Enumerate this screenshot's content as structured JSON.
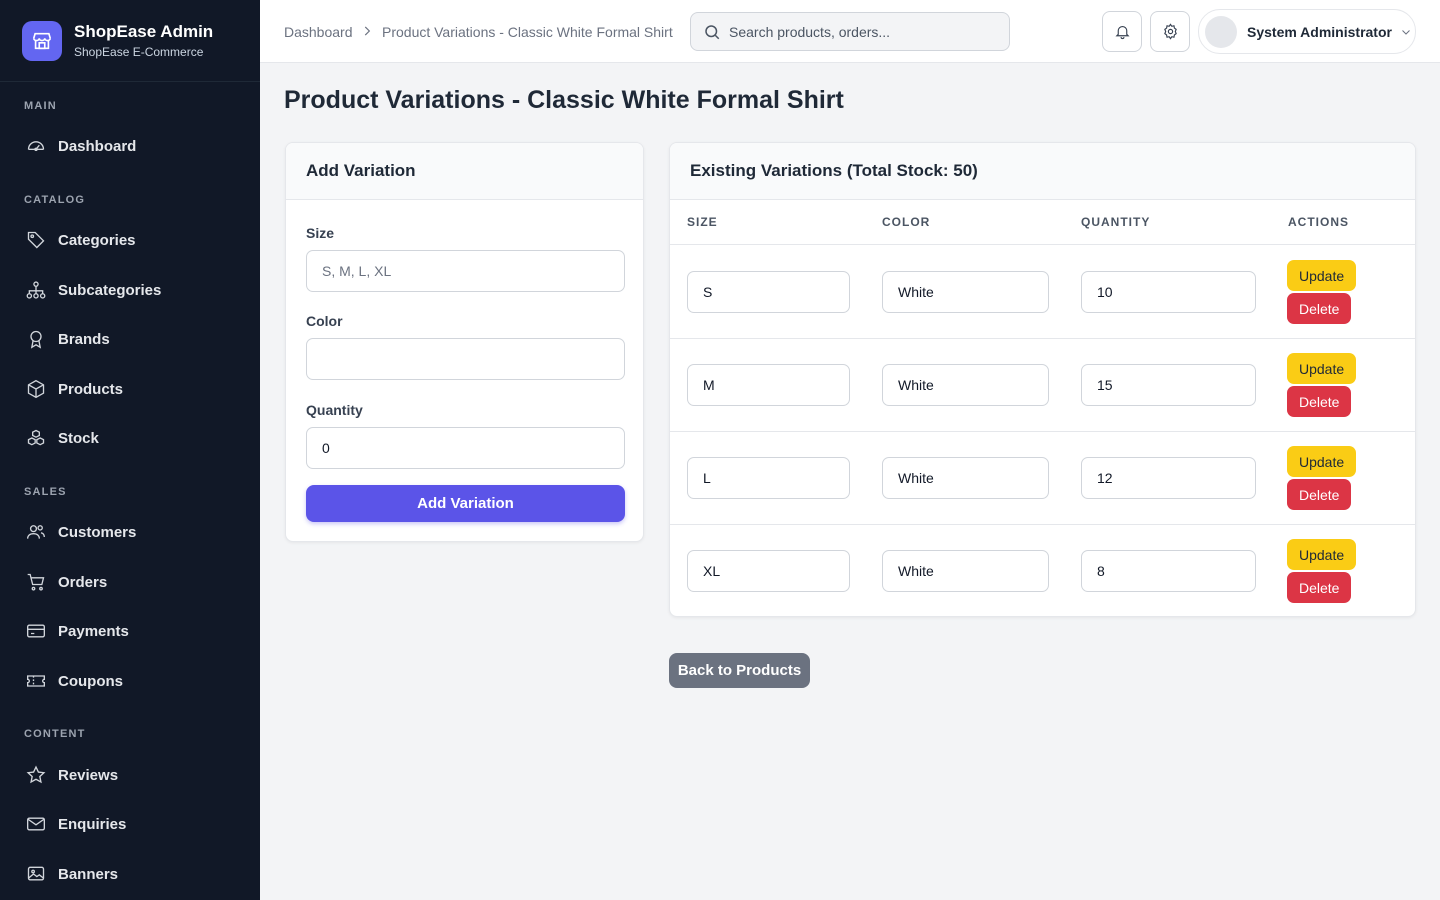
{
  "sidebar": {
    "brand_name": "ShopEase Admin",
    "brand_sub": "ShopEase E-Commerce",
    "sections": {
      "main": "MAIN",
      "catalog": "CATALOG",
      "sales": "SALES",
      "content": "CONTENT"
    },
    "items": {
      "dashboard": "Dashboard",
      "categories": "Categories",
      "subcategories": "Subcategories",
      "brands": "Brands",
      "products": "Products",
      "stock": "Stock",
      "customers": "Customers",
      "orders": "Orders",
      "payments": "Payments",
      "coupons": "Coupons",
      "reviews": "Reviews",
      "enquiries": "Enquiries",
      "banners": "Banners"
    }
  },
  "header": {
    "breadcrumb_home": "Dashboard",
    "breadcrumb_current": "Product Variations - Classic White Formal Shirt",
    "search_placeholder": "Search products, orders...",
    "user_name": "System Administrator"
  },
  "page": {
    "title": "Product Variations - Classic White Formal Shirt"
  },
  "add_form": {
    "heading": "Add Variation",
    "size_label": "Size",
    "size_placeholder": "S, M, L, XL",
    "color_label": "Color",
    "color_value": "",
    "quantity_label": "Quantity",
    "quantity_value": "0",
    "submit_label": "Add Variation"
  },
  "variations": {
    "heading": "Existing Variations (Total Stock: 50)",
    "columns": {
      "size": "SIZE",
      "color": "COLOR",
      "quantity": "QUANTITY",
      "actions": "ACTIONS"
    },
    "update_label": "Update",
    "delete_label": "Delete",
    "rows": [
      {
        "size": "S",
        "color": "White",
        "quantity": "10"
      },
      {
        "size": "M",
        "color": "White",
        "quantity": "15"
      },
      {
        "size": "L",
        "color": "White",
        "quantity": "12"
      },
      {
        "size": "XL",
        "color": "White",
        "quantity": "8"
      }
    ]
  },
  "back_label": "Back to Products",
  "colors": {
    "sidebar_bg": "#111827",
    "accent": "#5b54e8",
    "update": "#facc15",
    "delete": "#dc3545",
    "back": "#6b7280"
  }
}
